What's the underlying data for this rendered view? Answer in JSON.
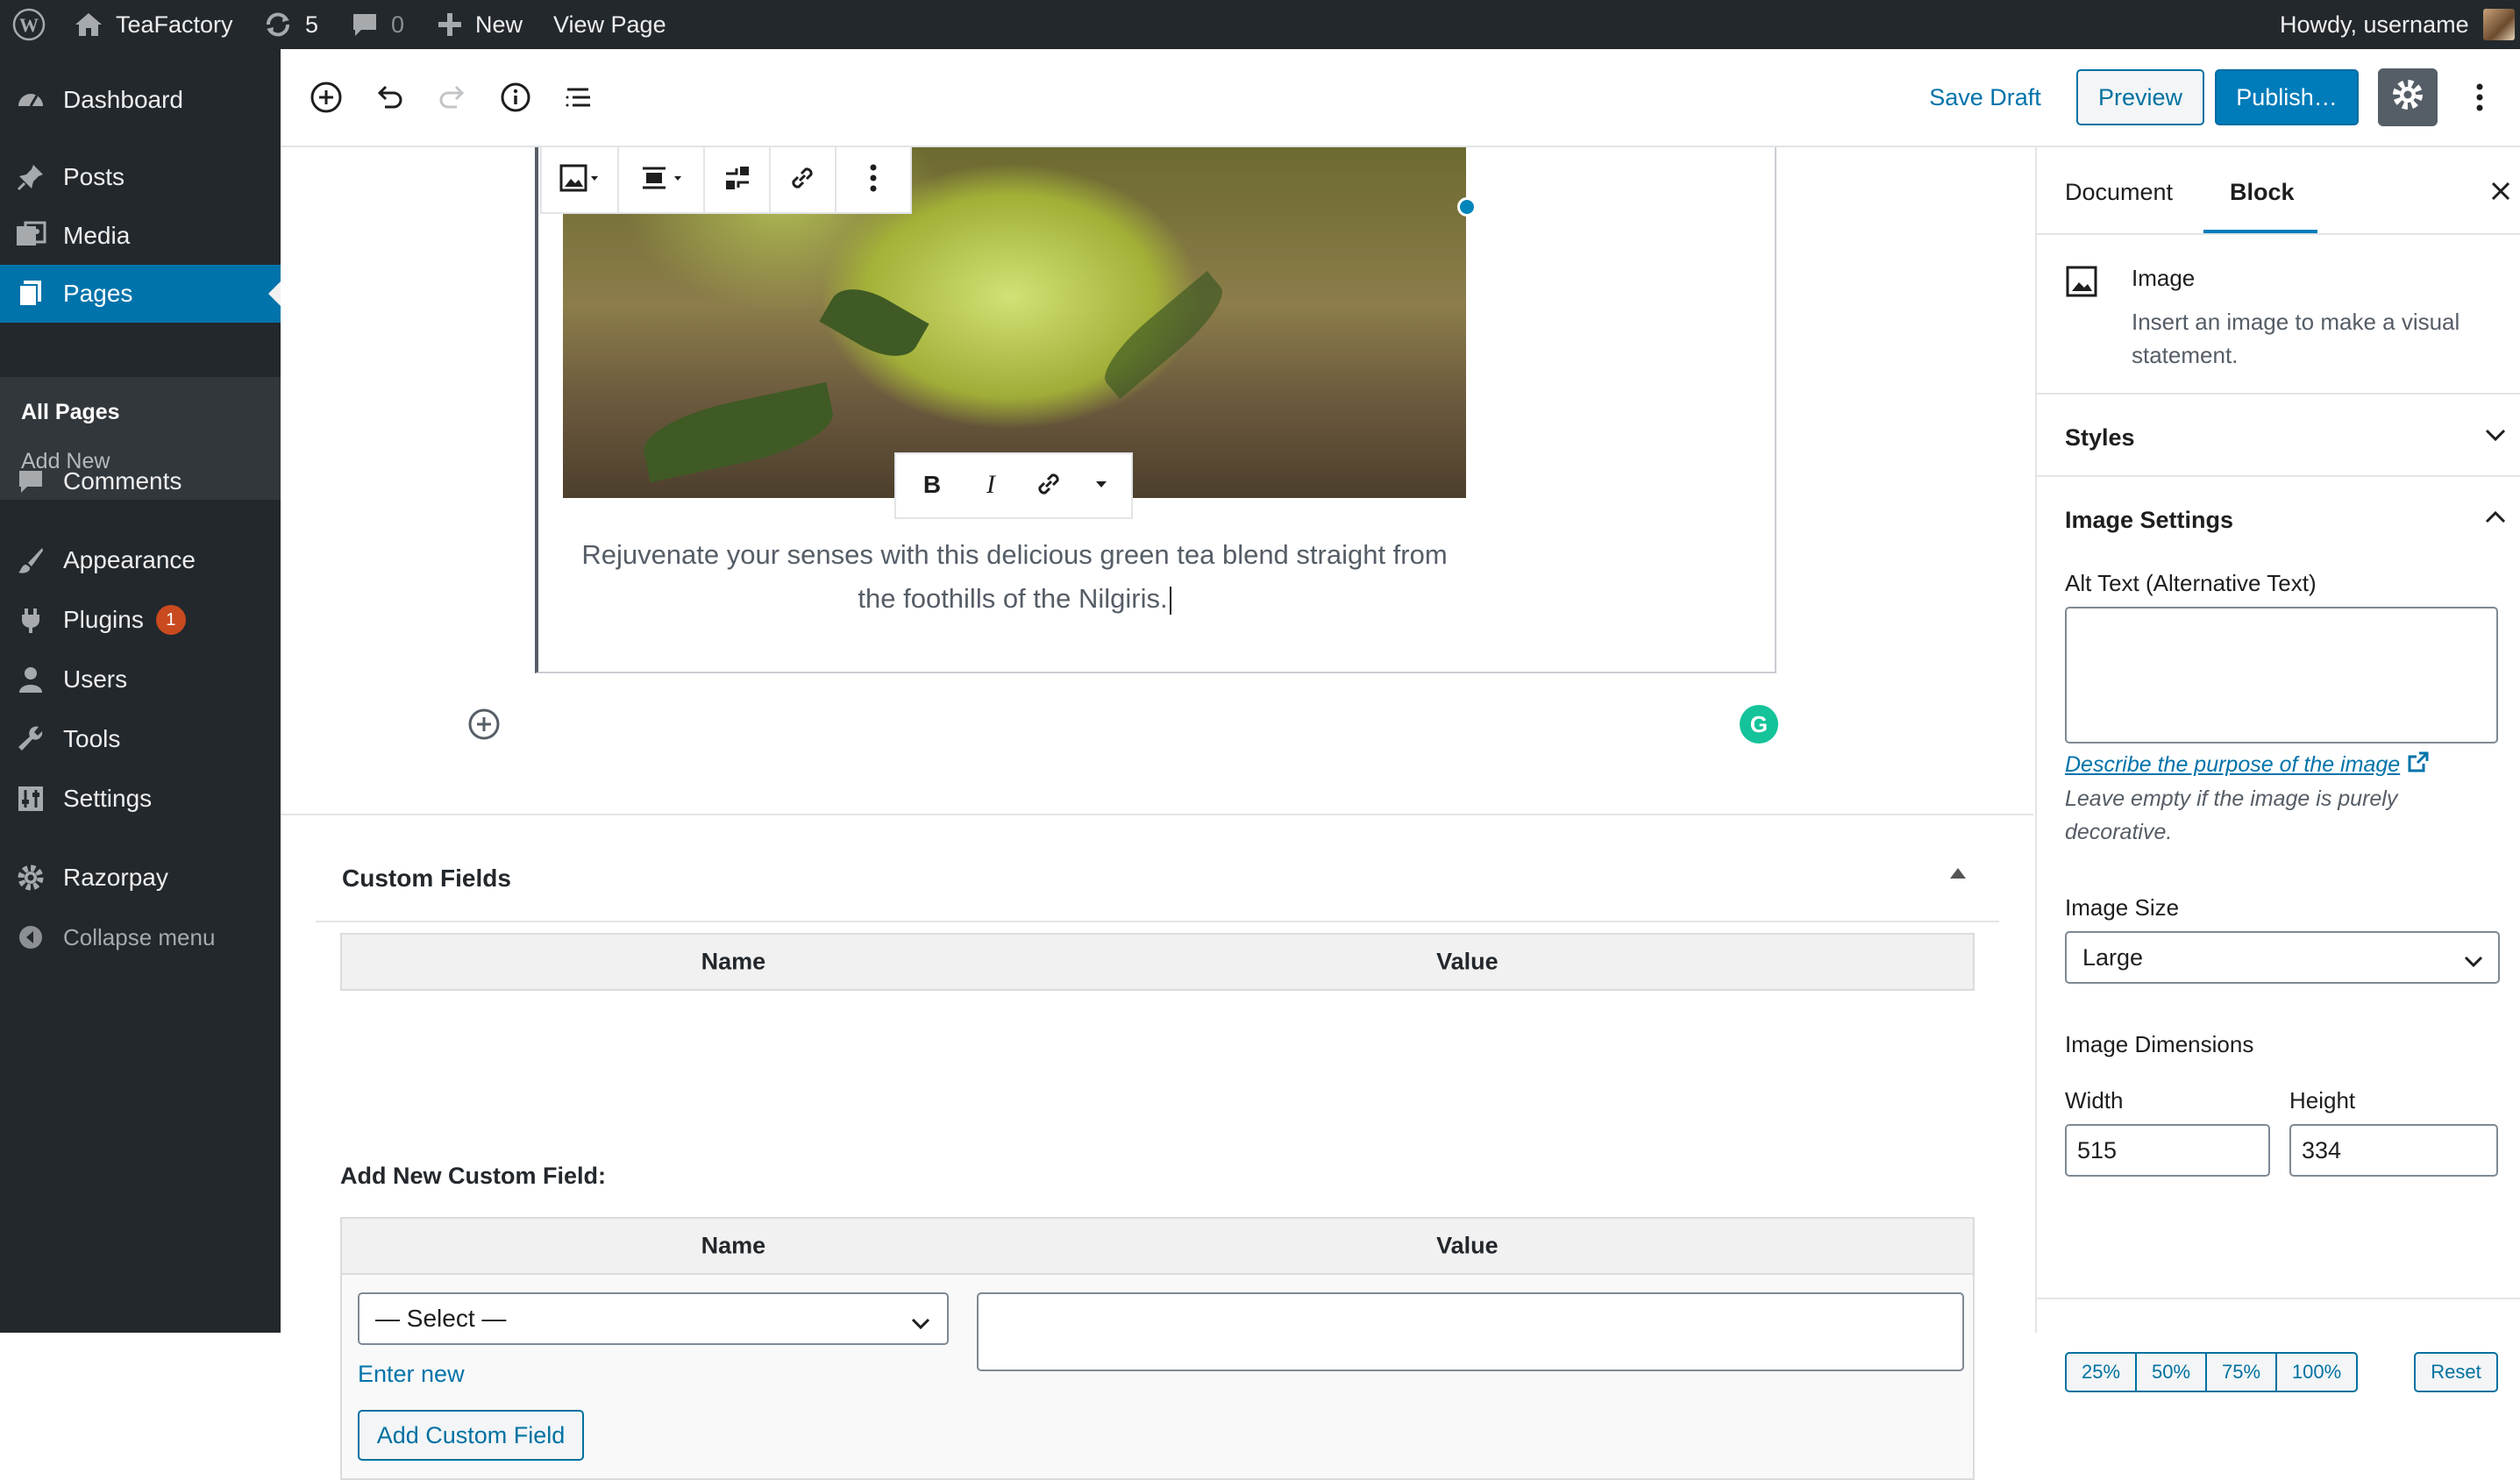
{
  "adminbar": {
    "site_name": "TeaFactory",
    "updates_count": "5",
    "comments_count": "0",
    "new_label": "New",
    "view_page_label": "View Page",
    "greeting": "Howdy, username"
  },
  "menu": {
    "items": [
      {
        "label": "Dashboard",
        "icon": "dashboard-icon"
      },
      {
        "label": "Posts",
        "icon": "pushpin-icon"
      },
      {
        "label": "Media",
        "icon": "media-icon"
      },
      {
        "label": "Pages",
        "icon": "pages-icon"
      },
      {
        "label": "Comments",
        "icon": "comment-icon"
      },
      {
        "label": "Appearance",
        "icon": "paintbrush-icon"
      },
      {
        "label": "Plugins",
        "icon": "plugin-icon"
      },
      {
        "label": "Users",
        "icon": "user-icon"
      },
      {
        "label": "Tools",
        "icon": "wrench-icon"
      },
      {
        "label": "Settings",
        "icon": "sliders-icon"
      },
      {
        "label": "Razorpay",
        "icon": "gear-icon"
      },
      {
        "label": "Collapse menu",
        "icon": "collapse-icon"
      }
    ],
    "plugins_badge": "1",
    "submenu": [
      "All Pages",
      "Add New"
    ]
  },
  "header": {
    "save_draft": "Save Draft",
    "preview": "Preview",
    "publish": "Publish…"
  },
  "content": {
    "caption_line1": "Rejuvenate your senses with this delicious green tea blend straight from",
    "caption_line2": "the foothills of the Nilgiris.",
    "grammarly_letter": "G"
  },
  "custom_fields": {
    "title": "Custom Fields",
    "col_name": "Name",
    "col_value": "Value",
    "add_new_label": "Add New Custom Field:",
    "select_value": "— Select —",
    "enter_new": "Enter new",
    "add_button": "Add Custom Field"
  },
  "sidebar": {
    "tab_document": "Document",
    "tab_block": "Block",
    "block_name": "Image",
    "block_desc_1": "Insert an image to make a visual",
    "block_desc_2": "statement.",
    "styles_title": "Styles",
    "image_settings_title": "Image Settings",
    "alt_text_label": "Alt Text (Alternative Text)",
    "describe_link": "Describe the purpose of the image",
    "leave_empty_1": "Leave empty if the image is purely",
    "leave_empty_2": "decorative.",
    "image_size_label": "Image Size",
    "image_size_value": "Large",
    "dimensions_label": "Image Dimensions",
    "width_label": "Width",
    "height_label": "Height",
    "width_value": "515",
    "height_value": "334",
    "pct_25": "25%",
    "pct_50": "50%",
    "pct_75": "75%",
    "pct_100": "100%",
    "reset": "Reset"
  },
  "colors": {
    "admin_dark": "#23282d",
    "accent_blue": "#0073aa",
    "primary_button": "#007cba",
    "badge_orange": "#ca4a1f",
    "grammarly_green": "#15c39a"
  }
}
